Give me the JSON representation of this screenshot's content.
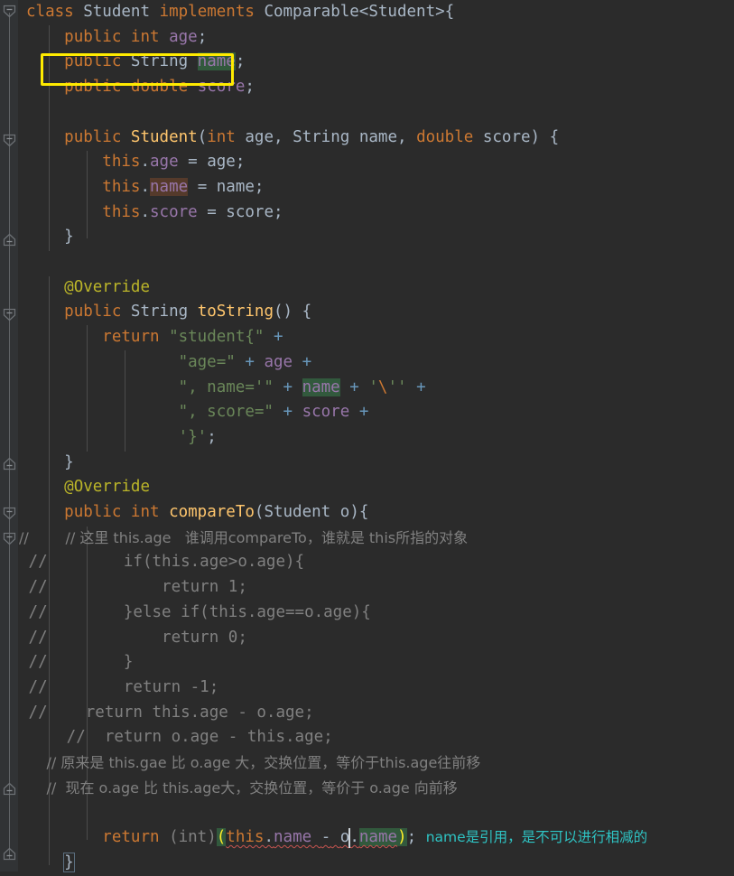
{
  "editor": {
    "language": "Java",
    "theme": "Darcula",
    "background": "#2b2b2b",
    "gutter_background": "#313335",
    "default_text_color": "#a9b7c6"
  },
  "annotation": {
    "type": "rectangle-highlight",
    "color": "#ffeb00",
    "target_line": 3,
    "target_text": "public String name;"
  },
  "colors": {
    "keyword": "#cc7832",
    "field": "#9876aa",
    "method": "#ffc66d",
    "string": "#6a8759",
    "comment": "#808080",
    "annotation": "#bbb529",
    "number": "#6897bb",
    "identifier": "#a9b7c6",
    "error_underline": "#c75450",
    "matched_paren": "#ffef28",
    "inline_hint": "#2ec4c4",
    "read_usage_highlight": "#32593d",
    "write_usage_highlight": "#553a2b"
  },
  "inline_hint": {
    "text": "name是引用，是不可以进行相减的",
    "color": "#2ec4c4",
    "line": 34
  },
  "gutter": {
    "fold_markers": [
      {
        "line": 1,
        "state": "expanded",
        "shape": "minus-down"
      },
      {
        "line": 7,
        "state": "expanded",
        "shape": "minus-down"
      },
      {
        "line": 11,
        "state": "end",
        "shape": "minus-up"
      },
      {
        "line": 14,
        "state": "expanded",
        "shape": "minus-down"
      },
      {
        "line": 21,
        "state": "end",
        "shape": "minus-up"
      },
      {
        "line": 23,
        "state": "expanded",
        "shape": "minus-down"
      },
      {
        "line": 24,
        "state": "expanded",
        "shape": "minus-down"
      },
      {
        "line": 33,
        "state": "end",
        "shape": "minus-up"
      },
      {
        "line": 35,
        "state": "end",
        "shape": "minus-up"
      }
    ]
  },
  "code": {
    "lines": [
      {
        "n": 1,
        "text": "class Student implements Comparable<Student>{"
      },
      {
        "n": 2,
        "text": "    public int age;"
      },
      {
        "n": 3,
        "text": "    public String name;"
      },
      {
        "n": 4,
        "text": "    public double score;"
      },
      {
        "n": 5,
        "text": ""
      },
      {
        "n": 6,
        "text": "    public Student(int age, String name, double score) {"
      },
      {
        "n": 7,
        "text": "        this.age = age;"
      },
      {
        "n": 8,
        "text": "        this.name = name;"
      },
      {
        "n": 9,
        "text": "        this.score = score;"
      },
      {
        "n": 10,
        "text": "    }"
      },
      {
        "n": 11,
        "text": ""
      },
      {
        "n": 12,
        "text": "    @Override"
      },
      {
        "n": 13,
        "text": "    public String toString() {"
      },
      {
        "n": 14,
        "text": "        return \"student{\" +"
      },
      {
        "n": 15,
        "text": "                \"age=\" + age +"
      },
      {
        "n": 16,
        "text": "                \", name='\" + name + '\\'' +"
      },
      {
        "n": 17,
        "text": "                \", score=\" + score +"
      },
      {
        "n": 18,
        "text": "                '}';"
      },
      {
        "n": 19,
        "text": "    }"
      },
      {
        "n": 20,
        "text": "    @Override"
      },
      {
        "n": 21,
        "text": "    public int compareTo(Student o){"
      },
      {
        "n": 22,
        "text": "//        // 这里 this.age   谁调用compareTo，谁就是 this所指的对象"
      },
      {
        "n": 23,
        "text": " //        if(this.age>o.age){"
      },
      {
        "n": 24,
        "text": " //            return 1;"
      },
      {
        "n": 25,
        "text": " //        }else if(this.age==o.age){"
      },
      {
        "n": 26,
        "text": " //            return 0;"
      },
      {
        "n": 27,
        "text": " //        }"
      },
      {
        "n": 28,
        "text": " //        return -1;"
      },
      {
        "n": 29,
        "text": " //    return this.age - o.age;"
      },
      {
        "n": 30,
        "text": "     //  return o.age - this.age;"
      },
      {
        "n": 31,
        "text": "      // 原来是 this.gae 比 o.age 大，交换位置，等价于this.age往前移"
      },
      {
        "n": 32,
        "text": "      //  现在 o.age 比 this.age大，交换位置，等价于 o.age 向前移"
      },
      {
        "n": 33,
        "text": ""
      },
      {
        "n": 34,
        "text": "        return (int)(this.name - o.name); name是引用，是不可以进行相减的"
      },
      {
        "n": 35,
        "text": "    }"
      }
    ]
  },
  "tokens": {
    "l1": {
      "kw_class": "class",
      "name": "Student",
      "kw_implements": "implements",
      "iface": "Comparable<Student>{"
    },
    "l2": {
      "kw": "public",
      "type": "int",
      "field": "age",
      "semi": ";"
    },
    "l3": {
      "kw": "public",
      "type": "String",
      "field": "name",
      "semi": ";"
    },
    "l4": {
      "kw": "public",
      "type": "double",
      "field": "score",
      "semi": ";"
    },
    "l6": {
      "kw": "public",
      "ctor": "Student",
      "p1t": "int",
      "p1n": "age",
      "p2t": "String",
      "p2n": "name",
      "p3t": "double",
      "p3n": "score"
    },
    "l7": {
      "this": "this",
      "field": "age",
      "rhs": "age"
    },
    "l8": {
      "this": "this",
      "field": "name",
      "rhs": "name"
    },
    "l9": {
      "this": "this",
      "field": "score",
      "rhs": "score"
    },
    "l12": {
      "ann": "@Override"
    },
    "l13": {
      "kw": "public",
      "type": "String",
      "fn": "toString"
    },
    "l14": {
      "kw": "return",
      "str": "\"student{\""
    },
    "l15": {
      "str": "\"age=\"",
      "field": "age"
    },
    "l16": {
      "str": "\", name='\"",
      "field": "name",
      "esc": "'\\''"
    },
    "l17": {
      "str": "\", score=\"",
      "field": "score"
    },
    "l18": {
      "str": "'}'"
    },
    "l20": {
      "ann": "@Override"
    },
    "l21": {
      "kw": "public",
      "type": "int",
      "fn": "compareTo",
      "param_type": "Student",
      "param": "o"
    },
    "l34": {
      "kw": "return",
      "cast": "(int)",
      "this": "this",
      "field1": "name",
      "op": "-",
      "obj": "o",
      "field2": "name"
    }
  }
}
